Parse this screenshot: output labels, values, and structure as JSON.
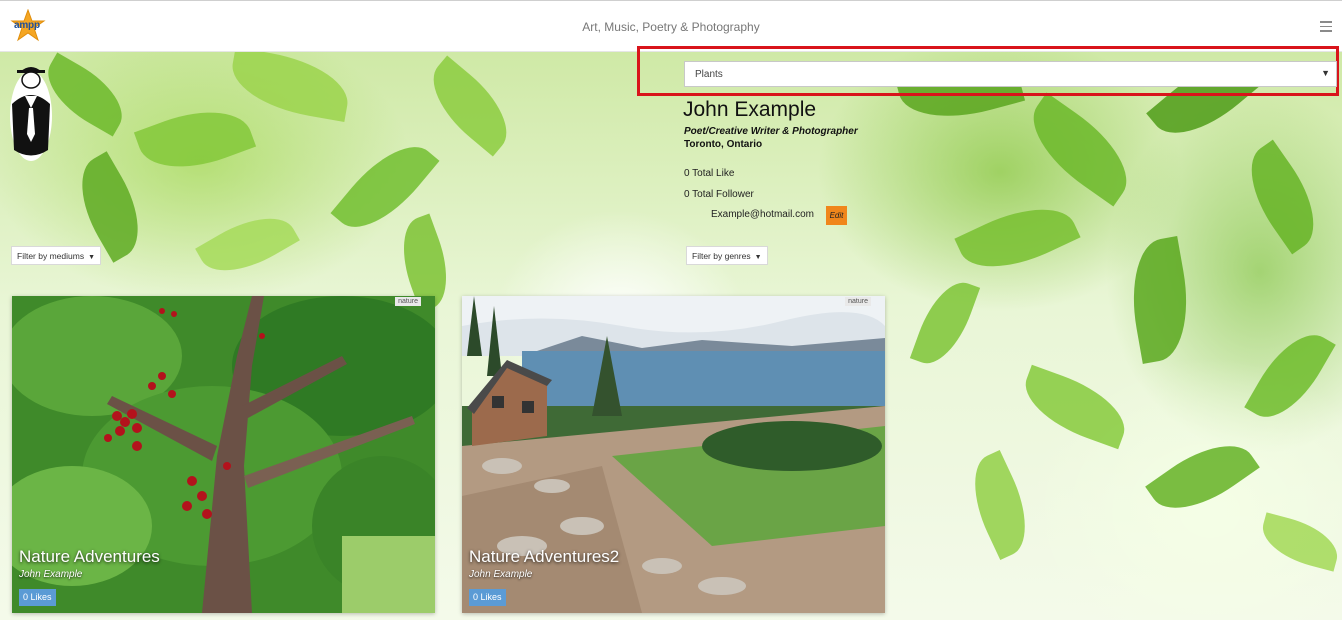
{
  "header": {
    "logo_text": "ampp",
    "tagline": "Art, Music, Poetry & Photography"
  },
  "genre_select": {
    "selected": "Plants"
  },
  "profile": {
    "name": "John Example",
    "role": "Poet/Creative Writer & Photographer",
    "location": "Toronto, Ontario",
    "total_likes": "0 Total Like",
    "total_followers": "0 Total Follower",
    "email": "Example@hotmail.com",
    "edit_label": "Edit"
  },
  "filters": {
    "mediums_label": "Filter by mediums",
    "genres_label": "Filter by genres"
  },
  "cards": [
    {
      "tag": "nature",
      "title": "Nature Adventures",
      "author": "John Example",
      "likes": "0 Likes"
    },
    {
      "tag": "nature",
      "title": "Nature Adventures2",
      "author": "John Example",
      "likes": "0 Likes"
    }
  ],
  "colors": {
    "accent_red": "#d9141b",
    "edit_orange": "#f0861b",
    "likes_blue": "#5b9bd5"
  }
}
